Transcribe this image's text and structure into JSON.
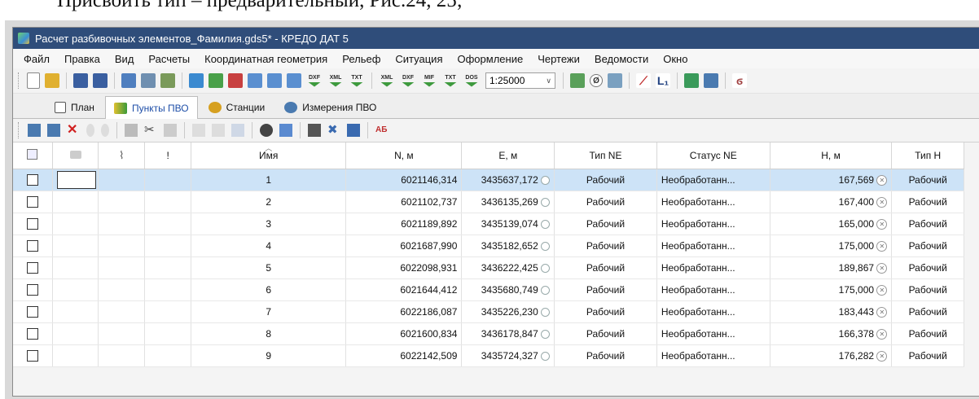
{
  "doc_caption": "Присвоить тип – предварительный, Рис.24, 25;",
  "window": {
    "title": "Расчет разбивочных элементов_Фамилия.gds5* - КРЕДО ДАТ 5"
  },
  "menu": [
    "Файл",
    "Правка",
    "Вид",
    "Расчеты",
    "Координатная геометрия",
    "Рельеф",
    "Ситуация",
    "Оформление",
    "Чертежи",
    "Ведомости",
    "Окно"
  ],
  "toolbar": {
    "text_tools": [
      "XML",
      "DXF",
      "MIF",
      "TXT",
      "DOS"
    ],
    "export_tools": [
      "DXF",
      "XML",
      "TXT"
    ],
    "scale_value": "1:25000",
    "l1_label": "L₁"
  },
  "tabs": [
    "План",
    "Пункты ПВО",
    "Станции",
    "Измерения ПВО"
  ],
  "toolbar2": {
    "ab_label": "АБ"
  },
  "table": {
    "columns": [
      "Имя",
      "N, м",
      "E, м",
      "Тип NE",
      "Статус NE",
      "H, м",
      "Тип H"
    ],
    "exclamation": "!",
    "rows": [
      {
        "name": "1",
        "n": "6021146,314",
        "e": "3435637,172",
        "type_ne": "Рабочий",
        "status_ne": "Необработанн...",
        "h": "167,569",
        "type_h": "Рабочий"
      },
      {
        "name": "2",
        "n": "6021102,737",
        "e": "3436135,269",
        "type_ne": "Рабочий",
        "status_ne": "Необработанн...",
        "h": "167,400",
        "type_h": "Рабочий"
      },
      {
        "name": "3",
        "n": "6021189,892",
        "e": "3435139,074",
        "type_ne": "Рабочий",
        "status_ne": "Необработанн...",
        "h": "165,000",
        "type_h": "Рабочий"
      },
      {
        "name": "4",
        "n": "6021687,990",
        "e": "3435182,652",
        "type_ne": "Рабочий",
        "status_ne": "Необработанн...",
        "h": "175,000",
        "type_h": "Рабочий"
      },
      {
        "name": "5",
        "n": "6022098,931",
        "e": "3436222,425",
        "type_ne": "Рабочий",
        "status_ne": "Необработанн...",
        "h": "189,867",
        "type_h": "Рабочий"
      },
      {
        "name": "6",
        "n": "6021644,412",
        "e": "3435680,749",
        "type_ne": "Рабочий",
        "status_ne": "Необработанн...",
        "h": "175,000",
        "type_h": "Рабочий"
      },
      {
        "name": "7",
        "n": "6022186,087",
        "e": "3435226,230",
        "type_ne": "Рабочий",
        "status_ne": "Необработанн...",
        "h": "183,443",
        "type_h": "Рабочий"
      },
      {
        "name": "8",
        "n": "6021600,834",
        "e": "3436178,847",
        "type_ne": "Рабочий",
        "status_ne": "Необработанн...",
        "h": "166,378",
        "type_h": "Рабочий"
      },
      {
        "name": "9",
        "n": "6022142,509",
        "e": "3435724,327",
        "type_ne": "Рабочий",
        "status_ne": "Необработанн...",
        "h": "176,282",
        "type_h": "Рабочий"
      }
    ]
  }
}
